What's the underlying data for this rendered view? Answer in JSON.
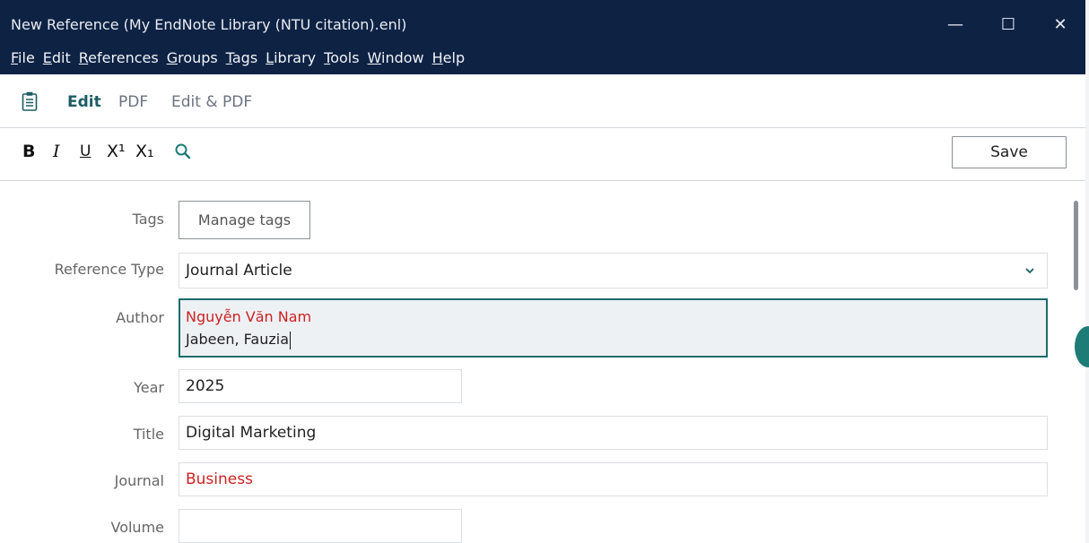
{
  "window": {
    "title": "New Reference (My EndNote Library (NTU citation).enl)",
    "controls": {
      "minimize": "—",
      "maximize": "☐",
      "close": "✕"
    }
  },
  "menu": [
    {
      "accel": "F",
      "rest": "ile"
    },
    {
      "accel": "E",
      "rest": "dit"
    },
    {
      "accel": "R",
      "rest": "eferences"
    },
    {
      "accel": "G",
      "rest": "roups"
    },
    {
      "accel": "T",
      "rest": "ags"
    },
    {
      "accel": "L",
      "rest": "ibrary"
    },
    {
      "accel": "T",
      "rest": "ools"
    },
    {
      "accel": "W",
      "rest": "indow"
    },
    {
      "accel": "H",
      "rest": "elp"
    }
  ],
  "tabs": {
    "edit": "Edit",
    "pdf": "PDF",
    "edit_pdf": "Edit & PDF"
  },
  "toolbar": {
    "bold": "B",
    "italic": "I",
    "underline": "U",
    "superscript": "X¹",
    "subscript": "X₁",
    "save_label": "Save"
  },
  "form": {
    "tags": {
      "label": "Tags",
      "button": "Manage tags"
    },
    "reference_type": {
      "label": "Reference Type",
      "value": "Journal Article"
    },
    "author": {
      "label": "Author",
      "lines": [
        "Nguyễn Văn Nam",
        "Jabeen, Fauzia"
      ]
    },
    "year": {
      "label": "Year",
      "value": "2025"
    },
    "title": {
      "label": "Title",
      "value": "Digital Marketing"
    },
    "journal": {
      "label": "Journal",
      "value": "Business"
    },
    "volume": {
      "label": "Volume",
      "value": ""
    }
  },
  "colors": {
    "titlebar": "#0e2244",
    "accent": "#1a6b6b",
    "error_red": "#cc2222"
  }
}
